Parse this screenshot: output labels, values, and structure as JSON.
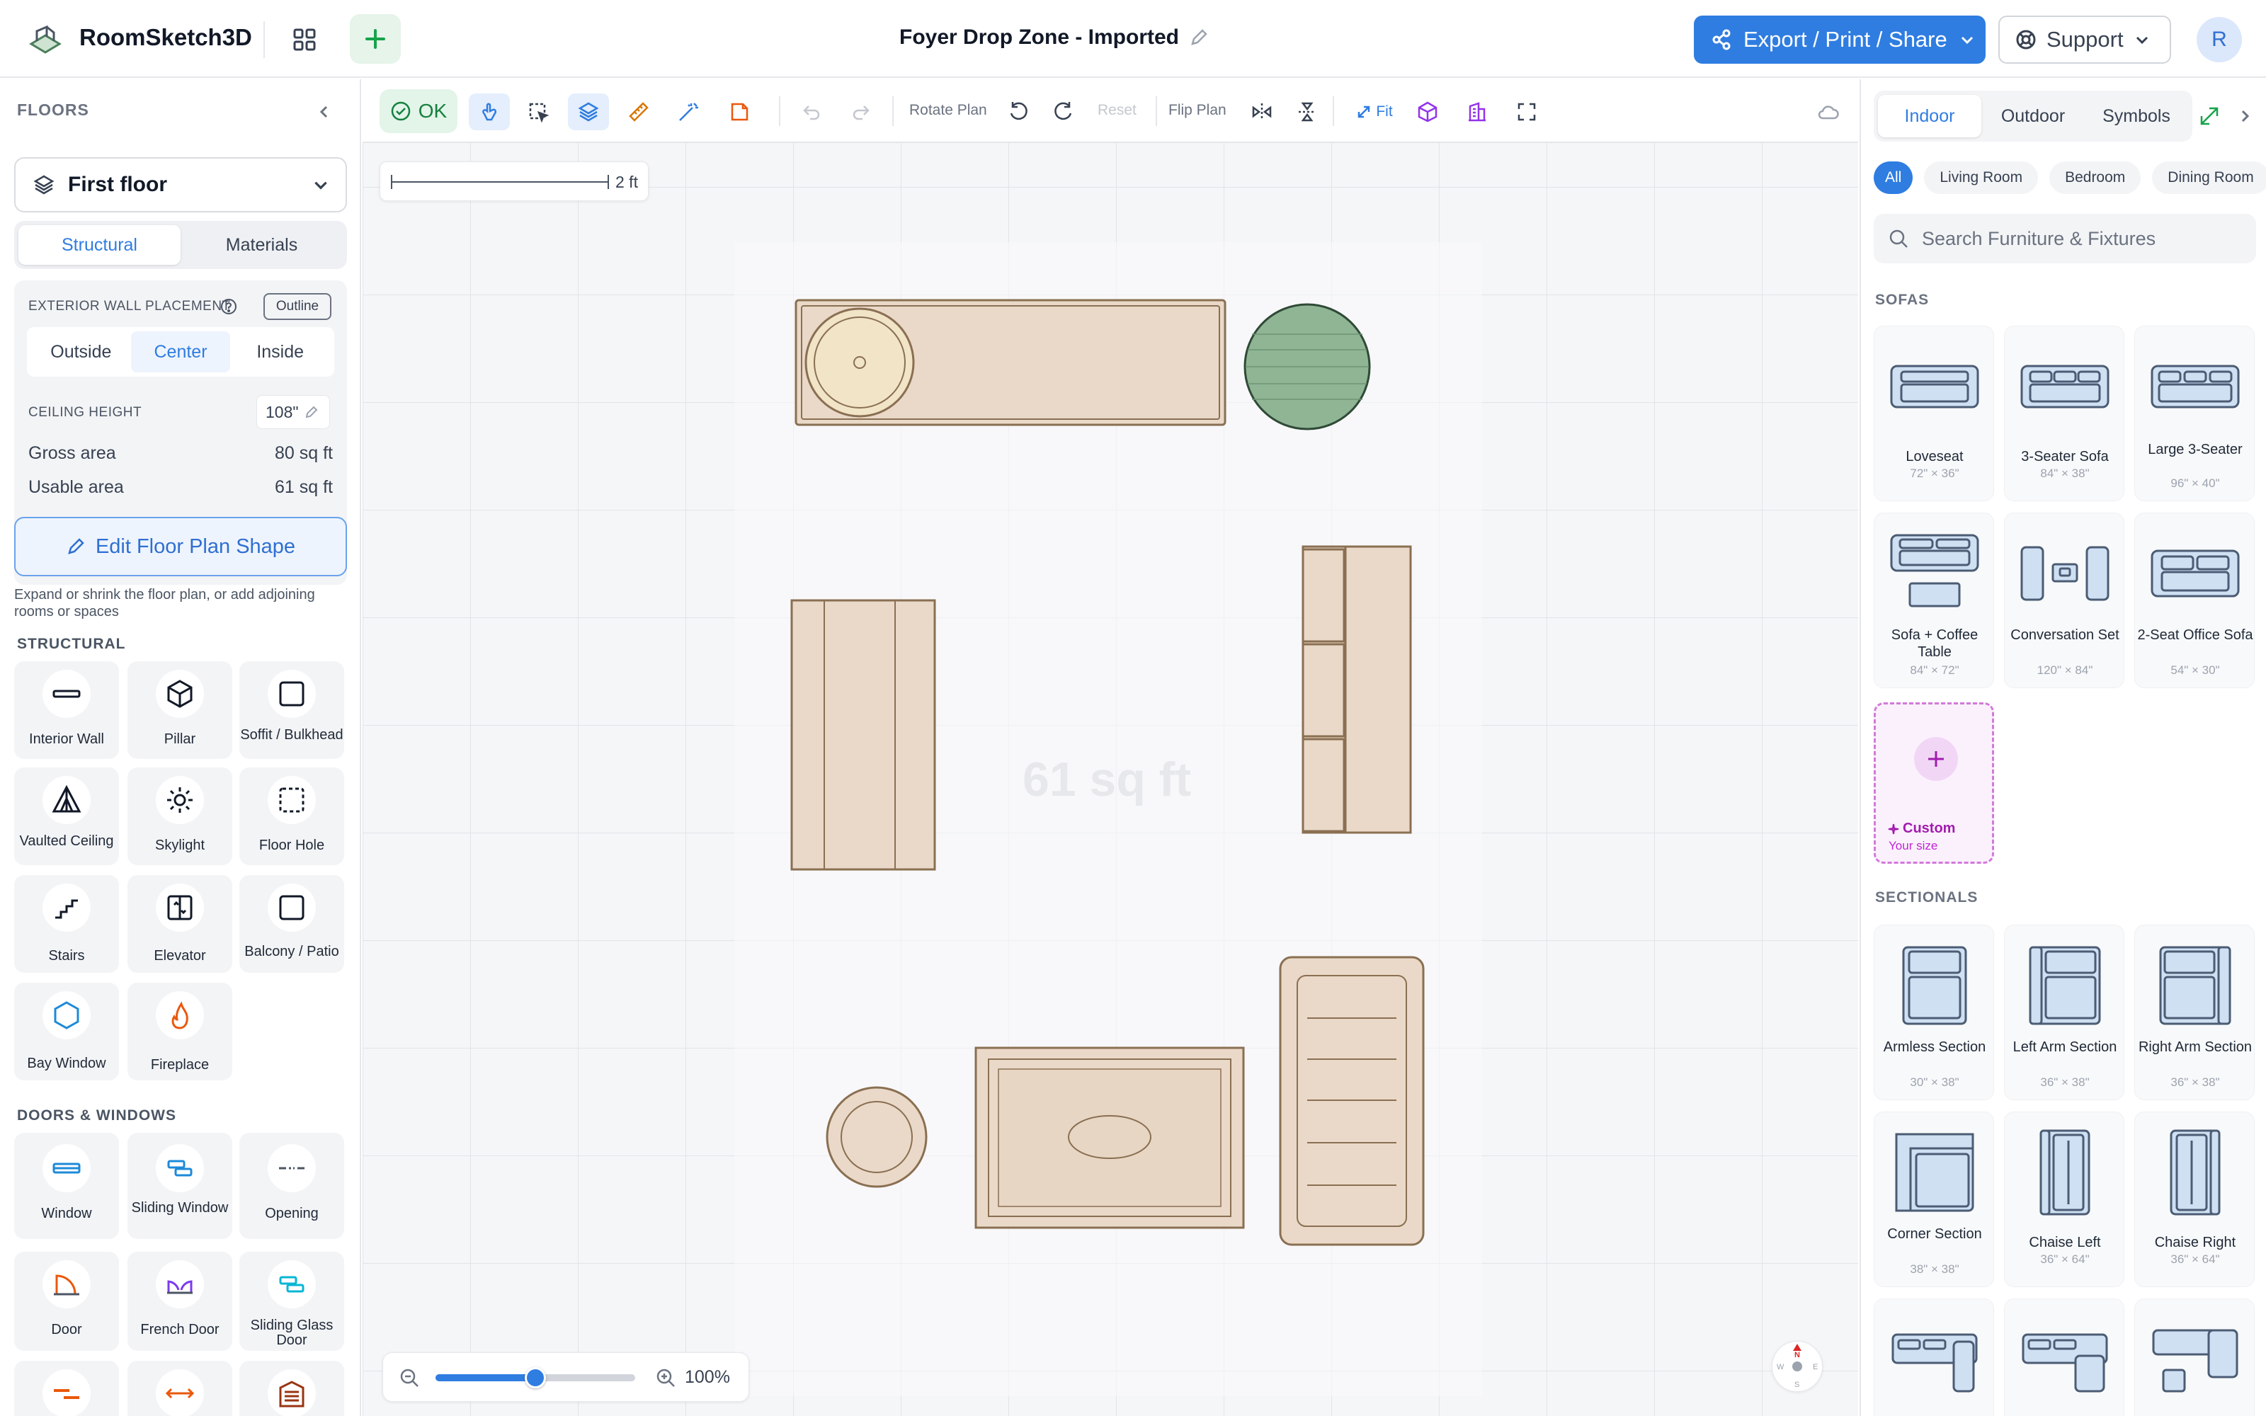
{
  "app": {
    "name": "RoomSketch3D",
    "doc_title": "Foyer Drop Zone - Imported"
  },
  "header": {
    "export_label": "Export / Print / Share",
    "support_label": "Support",
    "avatar_initial": "R"
  },
  "left": {
    "title": "FLOORS",
    "floor_select": "First floor",
    "tabs": [
      "Structural",
      "Materials"
    ],
    "wall_placement_label": "EXTERIOR WALL PLACEMENT",
    "outline_label": "Outline",
    "wall_options": [
      "Outside",
      "Center",
      "Inside"
    ],
    "ceiling_label": "CEILING HEIGHT",
    "ceiling_value": "108\"",
    "gross_label": "Gross area",
    "gross_value": "80 sq ft",
    "usable_label": "Usable area",
    "usable_value": "61 sq ft",
    "edit_shape": "Edit Floor Plan Shape",
    "edit_hint": "Expand or shrink the floor plan, or add adjoining rooms or spaces",
    "structural_title": "STRUCTURAL",
    "structural": [
      "Interior Wall",
      "Pillar",
      "Soffit / Bulkhead",
      "Vaulted Ceiling",
      "Skylight",
      "Floor Hole",
      "Stairs",
      "Elevator",
      "Balcony / Patio",
      "Bay Window",
      "Fireplace"
    ],
    "doors_title": "DOORS & WINDOWS",
    "doors": [
      "Window",
      "Sliding Window",
      "Opening",
      "Door",
      "French Door",
      "Sliding Glass Door"
    ]
  },
  "toolbar": {
    "ok": "OK",
    "rotate_plan": "Rotate Plan",
    "reset": "Reset",
    "flip_plan": "Flip Plan",
    "fit": "Fit"
  },
  "canvas": {
    "scale_label": "2 ft",
    "area_watermark": "61 sq ft",
    "zoom": "100%",
    "zoom_level": 0.5,
    "compass": {
      "n": "N",
      "w": "W",
      "e": "E",
      "s": "S"
    }
  },
  "right": {
    "tabs": [
      "Indoor",
      "Outdoor",
      "Symbols"
    ],
    "chips": [
      "All",
      "Living Room",
      "Bedroom",
      "Dining Room"
    ],
    "search_placeholder": "Search Furniture & Fixtures",
    "sofas_title": "SOFAS",
    "sofas": [
      {
        "name": "Loveseat",
        "dims": "72\" × 36\""
      },
      {
        "name": "3-Seater Sofa",
        "dims": "84\" × 38\""
      },
      {
        "name": "Large 3-Seater",
        "dims": "96\" × 40\""
      },
      {
        "name": "Sofa + Coffee Table",
        "dims": "84\" × 72\""
      },
      {
        "name": "Conversation Set",
        "dims": "120\" × 84\""
      },
      {
        "name": "2-Seat Office Sofa",
        "dims": "54\" × 30\""
      }
    ],
    "custom_label": "Custom",
    "custom_sub": "Your size",
    "sectionals_title": "SECTIONALS",
    "sectionals": [
      {
        "name": "Armless Section",
        "dims": "30\" × 38\""
      },
      {
        "name": "Left Arm Section",
        "dims": "36\" × 38\""
      },
      {
        "name": "Right Arm Section",
        "dims": "36\" × 38\""
      },
      {
        "name": "Corner Section",
        "dims": "38\" × 38\""
      },
      {
        "name": "Chaise Left",
        "dims": "36\" × 64\""
      },
      {
        "name": "Chaise Right",
        "dims": "36\" × 64\""
      }
    ]
  },
  "colors": {
    "accent": "#2f7de1",
    "furniture_fill": "#ead9c8",
    "furniture_stroke": "#8a6f52",
    "plant": "#8fb595",
    "ok_green": "#15803d"
  }
}
